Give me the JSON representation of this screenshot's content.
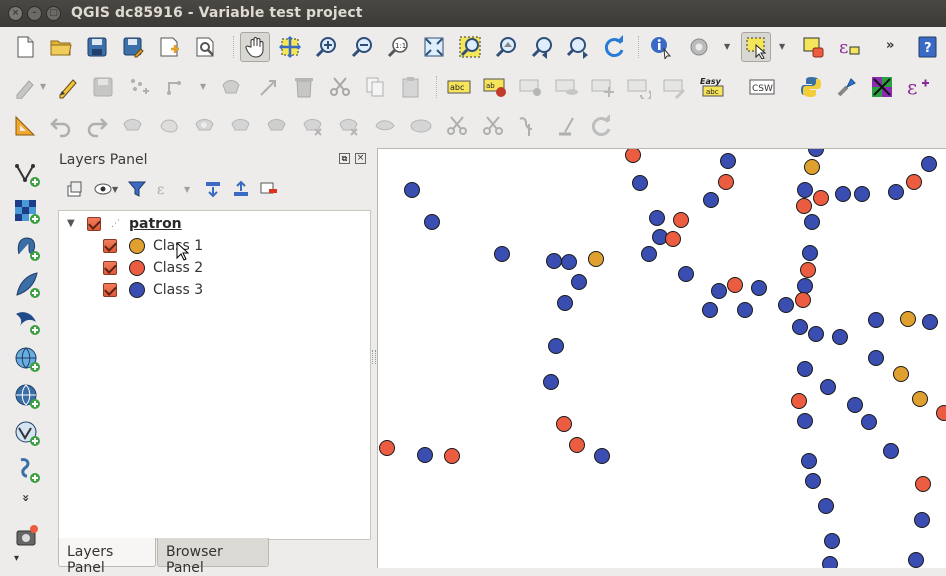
{
  "window": {
    "title": "QGIS dc85916 - Variable test project",
    "buttons": [
      "close",
      "minimize",
      "maximize"
    ]
  },
  "toolbars": {
    "row1": [
      {
        "name": "new-project-icon"
      },
      {
        "name": "open-project-icon"
      },
      {
        "name": "save-project-icon"
      },
      {
        "name": "save-as-icon"
      },
      {
        "name": "new-print-composer-icon"
      },
      {
        "name": "composer-manager-icon"
      },
      {
        "name": "pan-map-icon",
        "active": true
      },
      {
        "name": "pan-to-selection-icon"
      },
      {
        "name": "zoom-in-icon"
      },
      {
        "name": "zoom-out-icon"
      },
      {
        "name": "zoom-actual-size-icon"
      },
      {
        "name": "zoom-full-icon"
      },
      {
        "name": "zoom-to-selection-icon"
      },
      {
        "name": "zoom-to-layer-icon"
      },
      {
        "name": "zoom-last-icon"
      },
      {
        "name": "zoom-next-icon"
      },
      {
        "name": "refresh-icon"
      },
      {
        "name": "identify-icon"
      },
      {
        "name": "run-action-icon"
      },
      {
        "name": "select-features-icon"
      },
      {
        "name": "deselect-icon"
      },
      {
        "name": "expression-select-icon"
      },
      {
        "name": "help-icon"
      }
    ],
    "overflow_label": "»",
    "row2_labels": {
      "label_tool": "abc",
      "csw": "CSW",
      "easy": "Easy",
      "easy_sub": "abc"
    }
  },
  "layers_panel": {
    "title": "Layers Panel",
    "group": {
      "name": "patron",
      "checked": true,
      "expanded": true
    },
    "classes": [
      {
        "label": "Class 1",
        "color": "#e0a030",
        "checked": true
      },
      {
        "label": "Class 2",
        "color": "#ec5c40",
        "checked": true
      },
      {
        "label": "Class 3",
        "color": "#3a4db0",
        "checked": true
      }
    ]
  },
  "tabs": [
    {
      "label": "Layers Panel",
      "active": true
    },
    {
      "label": "Browser Panel",
      "active": false
    }
  ],
  "left_toolbar": {
    "more_label": "»"
  },
  "map": {
    "point_colors": {
      "class1": "#e0a030",
      "class2": "#ec5c40",
      "class3": "#3a4db0"
    }
  }
}
